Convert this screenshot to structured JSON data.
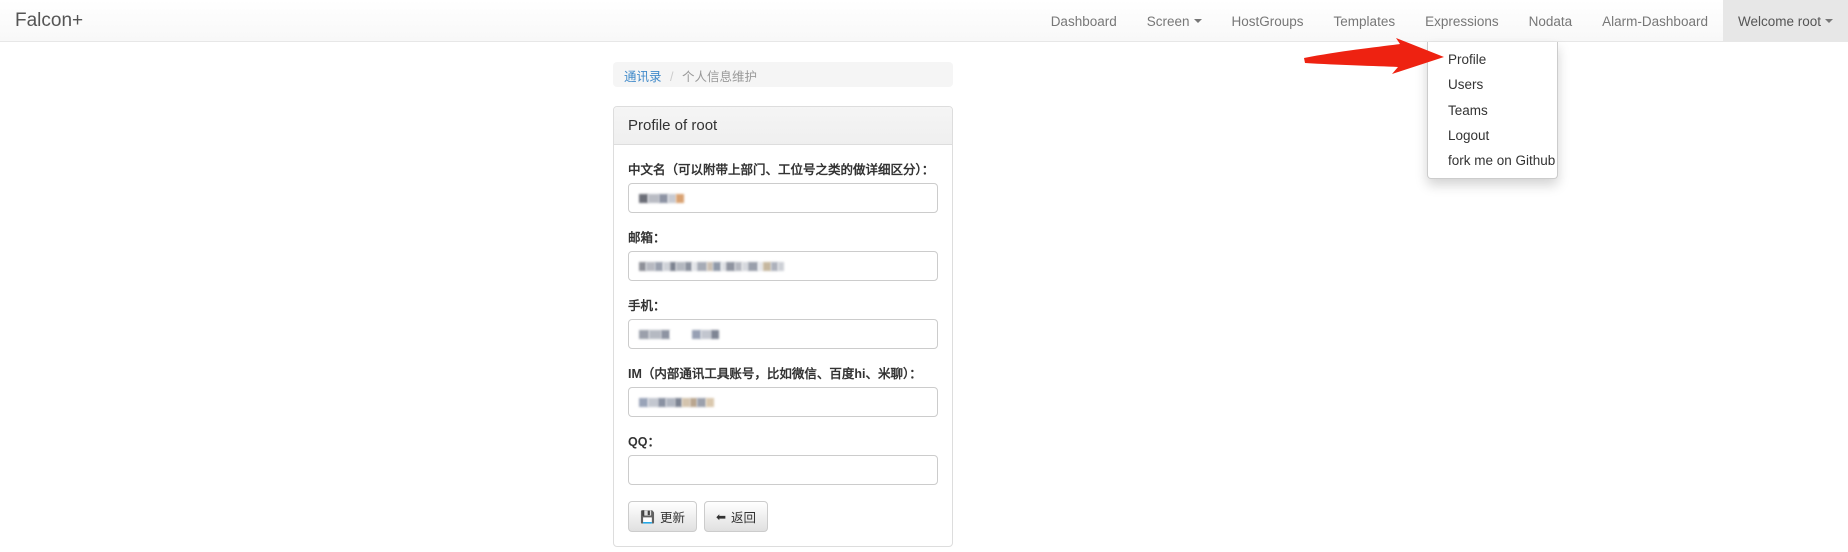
{
  "navbar": {
    "brand": "Falcon+",
    "items": [
      {
        "label": "Dashboard",
        "caret": false,
        "active": false
      },
      {
        "label": "Screen",
        "caret": true,
        "active": false
      },
      {
        "label": "HostGroups",
        "caret": false,
        "active": false
      },
      {
        "label": "Templates",
        "caret": false,
        "active": false
      },
      {
        "label": "Expressions",
        "caret": false,
        "active": false
      },
      {
        "label": "Nodata",
        "caret": false,
        "active": false
      },
      {
        "label": "Alarm-Dashboard",
        "caret": false,
        "active": false
      },
      {
        "label": "Welcome root",
        "caret": true,
        "active": true
      }
    ]
  },
  "dropdown": {
    "open": true,
    "items": [
      {
        "label": "Profile"
      },
      {
        "label": "Users"
      },
      {
        "label": "Teams"
      },
      {
        "label": "Logout"
      },
      {
        "label": "fork me on Github"
      }
    ]
  },
  "annotation": {
    "arrow_color": "#ee2211",
    "arrow_name": "pointer-arrow"
  },
  "breadcrumb": {
    "root": "通讯录",
    "separator": "/",
    "current": "个人信息维护",
    "link_color": "#428bca"
  },
  "panel": {
    "title": "Profile of root",
    "fields": [
      {
        "label": "中文名（可以附带上部门、工位号之类的做详细区分）：",
        "value": "",
        "placeholder": "",
        "redacted": true,
        "redact_blocks": [
          {
            "w": 9,
            "c": "#6b6e77"
          },
          {
            "w": 11,
            "c": "#b9bcc4"
          },
          {
            "w": 9,
            "c": "#8d93a3"
          },
          {
            "w": 8,
            "c": "#c7cad2"
          },
          {
            "w": 8,
            "c": "#d9a272"
          }
        ]
      },
      {
        "label": "邮箱：",
        "value": "",
        "placeholder": "",
        "redacted": true,
        "redact_blocks": [
          {
            "w": 7,
            "c": "#8e9098"
          },
          {
            "w": 9,
            "c": "#b7b9c1"
          },
          {
            "w": 8,
            "c": "#9aa0ae"
          },
          {
            "w": 7,
            "c": "#cfd2d8"
          },
          {
            "w": 6,
            "c": "#7d8390"
          },
          {
            "w": 9,
            "c": "#b3b7bf"
          },
          {
            "w": 7,
            "c": "#8b919e"
          },
          {
            "w": 5,
            "c": "#e2e4e8"
          },
          {
            "w": 10,
            "c": "#a6abb6"
          },
          {
            "w": 6,
            "c": "#cbc0b4"
          },
          {
            "w": 8,
            "c": "#9099a8"
          },
          {
            "w": 5,
            "c": "#dfe1e5"
          },
          {
            "w": 9,
            "c": "#8f94a0"
          },
          {
            "w": 7,
            "c": "#b5b8c0"
          },
          {
            "w": 6,
            "c": "#d7d9de"
          },
          {
            "w": 10,
            "c": "#9a9fab"
          },
          {
            "w": 5,
            "c": "#e6e7ea"
          },
          {
            "w": 8,
            "c": "#c6b79f"
          },
          {
            "w": 7,
            "c": "#adb1bb"
          },
          {
            "w": 6,
            "c": "#cdd0d6"
          }
        ]
      },
      {
        "label": "手机：",
        "value": "",
        "placeholder": "",
        "redacted": true,
        "redact_blocks": [
          {
            "w": 10,
            "c": "#9ba0ab"
          },
          {
            "w": 12,
            "c": "#b5b9c2"
          },
          {
            "w": 9,
            "c": "#8e94a2"
          },
          {
            "w": 22,
            "c": "#ffffff"
          },
          {
            "w": 9,
            "c": "#97a0b4"
          },
          {
            "w": 10,
            "c": "#c2c6cf"
          },
          {
            "w": 8,
            "c": "#7f8594"
          }
        ]
      },
      {
        "label": "IM（内部通讯工具账号，比如微信、百度hi、米聊）：",
        "value": "",
        "placeholder": "",
        "redacted": true,
        "redact_blocks": [
          {
            "w": 9,
            "c": "#99a3b8"
          },
          {
            "w": 10,
            "c": "#c3c7d0"
          },
          {
            "w": 8,
            "c": "#8a91a2"
          },
          {
            "w": 9,
            "c": "#b0b5c0"
          },
          {
            "w": 7,
            "c": "#7c8392"
          },
          {
            "w": 8,
            "c": "#d4c4ae"
          },
          {
            "w": 7,
            "c": "#b9a68f"
          },
          {
            "w": 9,
            "c": "#9ba0ac"
          },
          {
            "w": 8,
            "c": "#dac8ae"
          }
        ]
      },
      {
        "label": "QQ：",
        "value": "",
        "placeholder": "",
        "redacted": false,
        "redact_blocks": []
      }
    ],
    "buttons": [
      {
        "label": "更新",
        "icon": "save-icon",
        "glyph": "💾"
      },
      {
        "label": "返回",
        "icon": "back-arrow-icon",
        "glyph": "⬅"
      }
    ]
  }
}
